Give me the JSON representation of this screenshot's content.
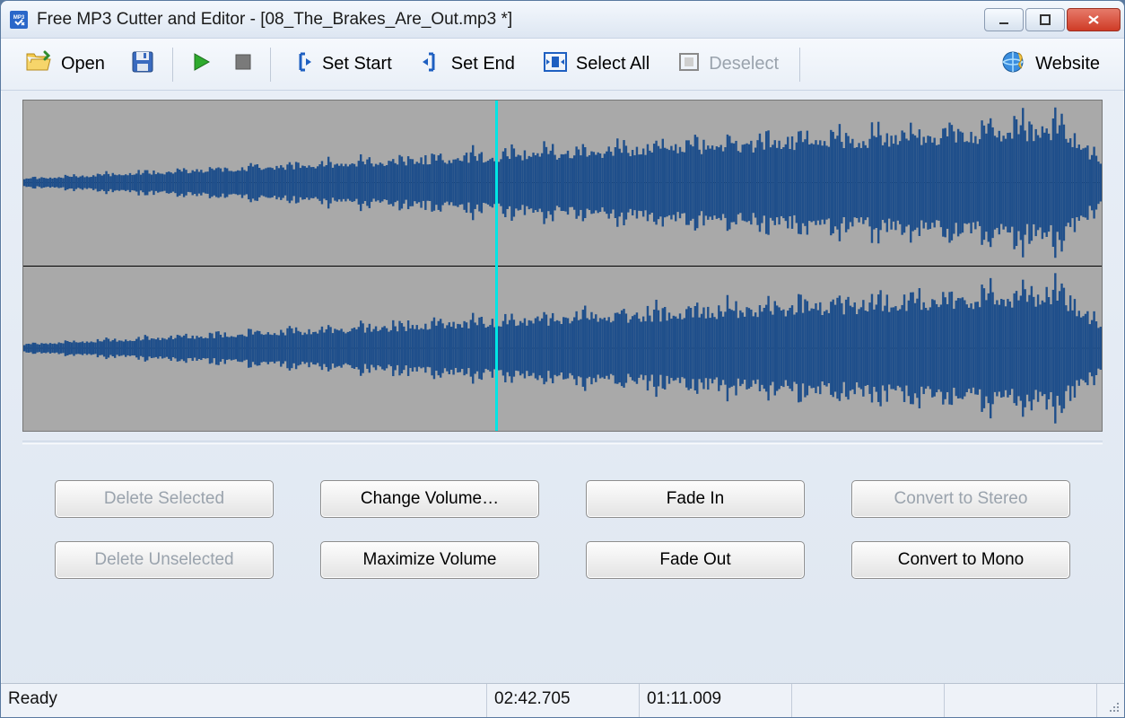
{
  "window": {
    "title": "Free MP3 Cutter and Editor - [08_The_Brakes_Are_Out.mp3 *]"
  },
  "toolbar": {
    "open": "Open",
    "set_start": "Set Start",
    "set_end": "Set End",
    "select_all": "Select All",
    "deselect": "Deselect",
    "website": "Website"
  },
  "actions": {
    "delete_selected": "Delete Selected",
    "change_volume": "Change Volume…",
    "fade_in": "Fade In",
    "convert_to_stereo": "Convert to Stereo",
    "delete_unselected": "Delete Unselected",
    "maximize_volume": "Maximize Volume",
    "fade_out": "Fade Out",
    "convert_to_mono": "Convert to Mono"
  },
  "status": {
    "state": "Ready",
    "total_time": "02:42.705",
    "position": "01:11.009"
  },
  "playhead_fraction": 0.438,
  "colors": {
    "wave": "#1f4f8b",
    "wave_bg": "#a9a9a9",
    "playhead": "#00e5e5"
  }
}
